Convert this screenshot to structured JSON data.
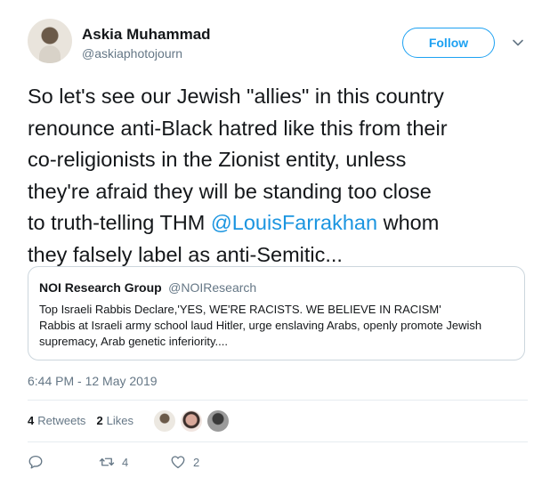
{
  "author": {
    "name": "Askia Muhammad",
    "handle": "@askiaphotojourn",
    "follow_label": "Follow"
  },
  "tweet": {
    "line1": "So let's see our Jewish \"allies\" in this country",
    "line2": "renounce anti-Black hatred like this from their",
    "line3": "co-religionists in the Zionist entity, unless",
    "line4": "they're afraid they will be standing too close",
    "line5_pre": "to truth-telling THM ",
    "mention": "@LouisFarrakhan",
    "line5_post": " whom",
    "line6": "they falsely label as anti-Semitic..."
  },
  "quoted": {
    "name": "NOI Research Group",
    "handle": "@NOIResearch",
    "line1": "Top Israeli Rabbis Declare,'YES, WE'RE RACISTS. WE BELIEVE IN RACISM'",
    "line2": "Rabbis at Israeli army school laud Hitler, urge enslaving Arabs, openly promote Jewish",
    "line3": "supremacy, Arab genetic inferiority...."
  },
  "timestamp": "6:44 PM - 12 May 2019",
  "stats": {
    "retweets_count": "4",
    "retweets_label": "Retweets",
    "likes_count": "2",
    "likes_label": "Likes"
  },
  "actions": {
    "reply_count": "",
    "retweet_count": "4",
    "like_count": "2"
  },
  "colors": {
    "accent": "#1da1f2",
    "mention": "#1b95e0",
    "muted": "#657786",
    "border": "#ccd6dd"
  },
  "icons": [
    "chevron-down-icon",
    "reply-icon",
    "retweet-icon",
    "heart-icon"
  ]
}
